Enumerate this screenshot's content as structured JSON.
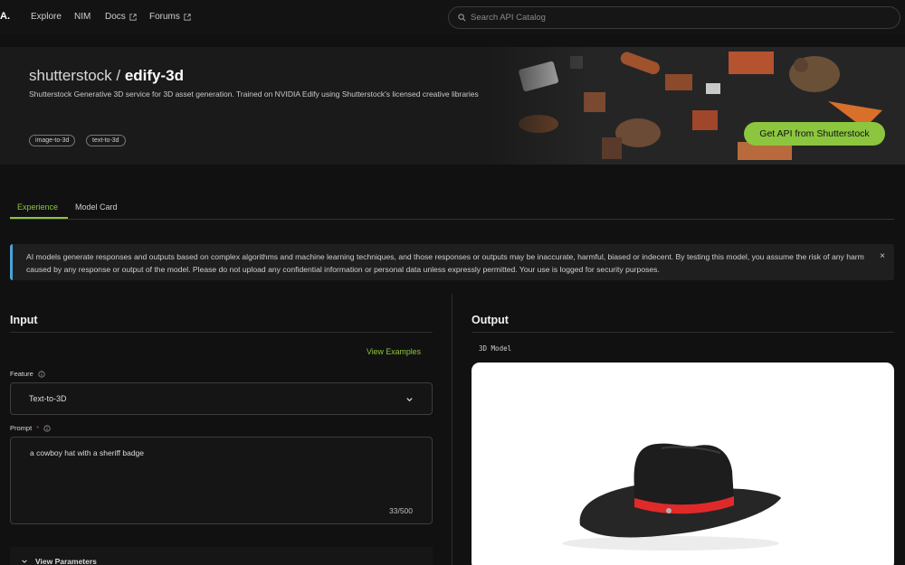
{
  "nav": {
    "logo": "A.",
    "links": [
      {
        "label": "Explore"
      },
      {
        "label": "NIM"
      },
      {
        "label": "Docs"
      },
      {
        "label": "Forums"
      }
    ],
    "search_placeholder": "Search API Catalog"
  },
  "hero": {
    "publisher": "shutterstock / ",
    "model": "edify-3d",
    "description": "Shutterstock Generative 3D service for 3D asset generation. Trained on NVIDIA Edify using Shutterstock's licensed creative libraries",
    "tags": [
      "image-to-3d",
      "text-to-3d"
    ],
    "cta": "Get API from Shutterstock",
    "accent_color": "#8cc63f"
  },
  "tabs": [
    {
      "label": "Experience",
      "active": true
    },
    {
      "label": "Model Card",
      "active": false
    }
  ],
  "notice": {
    "text": "AI models generate responses and outputs based on complex algorithms and machine learning techniques, and those responses or outputs may be inaccurate, harmful, biased or indecent. By testing this model, you assume the risk of any harm caused by any response or output of the model. Please do not upload any confidential information or personal data unless expressly permitted. Your use is logged for security purposes.",
    "close": "×"
  },
  "input": {
    "title": "Input",
    "view_examples": "View Examples",
    "feature_label": "Feature",
    "feature_value": "Text-to-3D",
    "prompt_label": "Prompt",
    "prompt_required": "*",
    "prompt_value": "a cowboy hat with a sheriff badge",
    "prompt_counter": "33/500",
    "params_label": "View Parameters"
  },
  "output": {
    "title": "Output",
    "model_label": "3D Model"
  }
}
